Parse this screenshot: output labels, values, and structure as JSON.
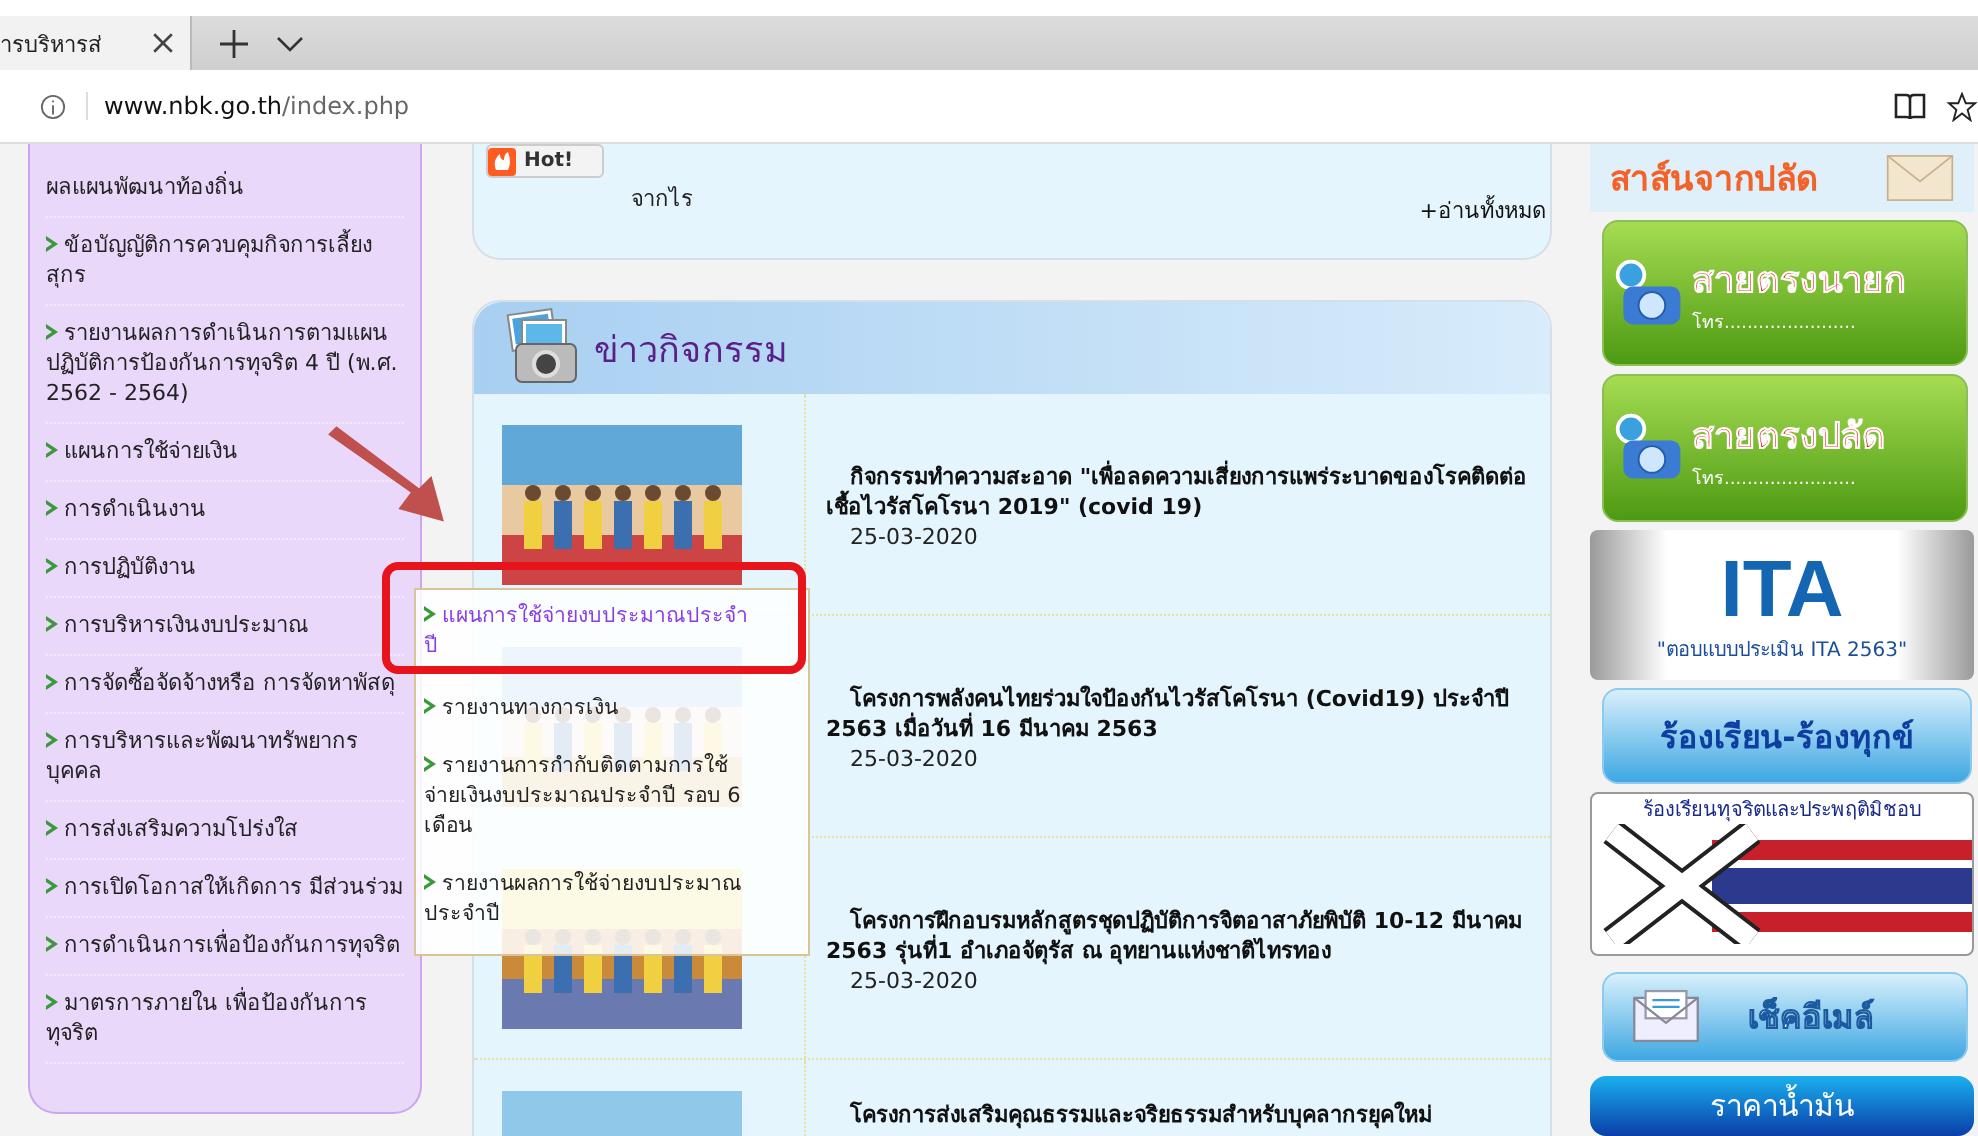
{
  "browser": {
    "tab": {
      "title": "ารบริหารส่"
    },
    "address": {
      "host": "www.nbk.go.th",
      "path": "/index.php"
    }
  },
  "sidebar": {
    "items": [
      {
        "label": "ผลแผนพัฒนาท้องถิ่น"
      },
      {
        "label": "ข้อบัญญัติการควบคุมกิจการเลี้ยงสุกร"
      },
      {
        "label": "รายงานผลการดำเนินการตามแผนปฏิบัติการป้องกันการทุจริต 4 ปี (พ.ศ. 2562 - 2564)"
      },
      {
        "label": "แผนการใช้จ่ายเงิน"
      },
      {
        "label": "การดำเนินงาน"
      },
      {
        "label": "การปฏิบัติงาน"
      },
      {
        "label": "การบริหารเงินงบประมาณ"
      },
      {
        "label": "การจัดซื้อจัดจ้างหรือ การจัดหาพัสดุ"
      },
      {
        "label": "การบริหารและพัฒนาทรัพยากรบุคคล"
      },
      {
        "label": "การส่งเสริมความโปร่งใส"
      },
      {
        "label": "การเปิดโอกาสให้เกิดการ มีส่วนร่วม"
      },
      {
        "label": "การดำเนินการเพื่อป้องกันการทุจริต"
      },
      {
        "label": "มาตรการภายใน เพื่อป้องกันการทุจริต"
      }
    ]
  },
  "news": {
    "badge": "Hot!",
    "text": "จากไร",
    "read_all": "+อ่านทั้งหมด"
  },
  "activities": {
    "title": "ข่าวกิจกรรม",
    "items": [
      {
        "title": "กิจกรรมทำความสะอาด \"เพื่อลดความเสี่ยงการแพร่ระบาดของโรคติดต่อเชื้อไวรัสโคโรนา 2019\" (covid 19)",
        "date": "25-03-2020"
      },
      {
        "title": "โครงการพลังคนไทยร่วมใจป้องกันไวรัสโคโรนา (Covid19) ประจำปี 2563 เมื่อวันที่ 16 มีนาคม 2563",
        "date": "25-03-2020"
      },
      {
        "title": "โครงการฝึกอบรมหลักสูตรชุดปฏิบัติการจิตอาสาภัยพิบัติ 10-12 มีนาคม 2563 รุ่นที่1 อำเภอจัตุรัส ณ อุทยานแห่งชาติไทรทอง",
        "date": "25-03-2020"
      },
      {
        "title": "โครงการส่งเสริมคุณธรรมและจริยธรรมสำหรับบุคลากรยุคใหม่"
      }
    ]
  },
  "dropdown": {
    "items": [
      {
        "label": "แผนการใช้จ่ายงบประมาณประจำปี",
        "selected": true
      },
      {
        "label": "รายงานทางการเงิน",
        "selected": false
      },
      {
        "label": "รายงานการกำกับติดตามการใช้จ่ายเงินงบประมาณประจำปี รอบ 6 เดือน",
        "selected": false
      },
      {
        "label": "รายงานผลการใช้จ่ายงบประมาณประจำปี",
        "selected": false
      }
    ]
  },
  "right_banners": [
    {
      "kind": "header",
      "title": "สาส์นจากปลัด"
    },
    {
      "kind": "hotline",
      "title": "สายตรงนายก",
      "phone": "โทร......................."
    },
    {
      "kind": "hotline",
      "title": "สายตรงปลัด",
      "phone": "โทร......................."
    },
    {
      "kind": "ita",
      "title": "ITA",
      "caption": "\"ตอบแบบประเมิน ITA 2563\""
    },
    {
      "kind": "blue",
      "title": "ร้องเรียน-ร้องทุกข์"
    },
    {
      "kind": "complaint",
      "title": "ร้องเรียนทุจริตและประพฤติมิชอบ"
    },
    {
      "kind": "email",
      "title": "เช็คอีเมล์"
    },
    {
      "kind": "oil",
      "title": "ราคาน้ำมัน"
    }
  ]
}
